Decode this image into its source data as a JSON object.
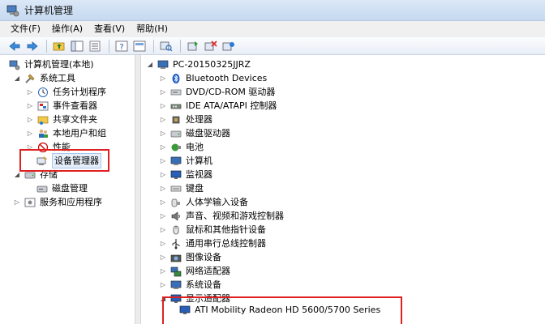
{
  "window": {
    "title": "计算机管理"
  },
  "menu": [
    "文件(F)",
    "操作(A)",
    "查看(V)",
    "帮助(H)"
  ],
  "left_tree": {
    "root": "计算机管理(本地)",
    "system_tools": "系统工具",
    "task_scheduler": "任务计划程序",
    "event_viewer": "事件查看器",
    "shared_folders": "共享文件夹",
    "local_users": "本地用户和组",
    "performance": "性能",
    "device_manager": "设备管理器",
    "storage": "存储",
    "disk_management": "磁盘管理",
    "services_apps": "服务和应用程序"
  },
  "right_tree": {
    "computer_name": "PC-20150325JJRZ",
    "categories": [
      "Bluetooth Devices",
      "DVD/CD-ROM 驱动器",
      "IDE ATA/ATAPI 控制器",
      "处理器",
      "磁盘驱动器",
      "电池",
      "计算机",
      "监视器",
      "键盘",
      "人体学输入设备",
      "声音、视频和游戏控制器",
      "鼠标和其他指针设备",
      "通用串行总线控制器",
      "图像设备",
      "网络适配器",
      "系统设备",
      "显示适配器"
    ],
    "display_adapter_child": "ATI Mobility Radeon HD 5600/5700 Series"
  },
  "colors": {
    "highlight": "#e02020",
    "titlebar": "#c5d9f0"
  }
}
